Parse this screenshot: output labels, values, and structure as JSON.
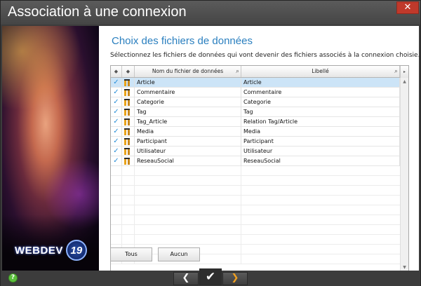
{
  "window": {
    "title": "Association à une connexion",
    "close_glyph": "✕"
  },
  "branding": {
    "logo_text": "WEBDEV",
    "logo_version": "19"
  },
  "content": {
    "heading": "Choix des fichiers de données",
    "instruction": "Sélectionnez les fichiers de données qui vont devenir des fichiers associés à la connexion choisie."
  },
  "table": {
    "columns": {
      "name": "Nom du fichier de données",
      "label": "Libellé"
    },
    "rows": [
      {
        "checked": true,
        "name": "Article",
        "label": "Article",
        "selected": true
      },
      {
        "checked": true,
        "name": "Commentaire",
        "label": "Commentaire",
        "selected": false
      },
      {
        "checked": true,
        "name": "Categorie",
        "label": "Categorie",
        "selected": false
      },
      {
        "checked": true,
        "name": "Tag",
        "label": "Tag",
        "selected": false
      },
      {
        "checked": true,
        "name": "Tag_Article",
        "label": "Relation Tag/Article",
        "selected": false
      },
      {
        "checked": true,
        "name": "Media",
        "label": "Media",
        "selected": false
      },
      {
        "checked": true,
        "name": "Participant",
        "label": "Participant",
        "selected": false
      },
      {
        "checked": true,
        "name": "Utilisateur",
        "label": "Utilisateur",
        "selected": false
      },
      {
        "checked": true,
        "name": "ReseauSocial",
        "label": "ReseauSocial",
        "selected": false
      }
    ],
    "check_glyph": "✓"
  },
  "buttons": {
    "all": "Tous",
    "none": "Aucun"
  },
  "footer": {
    "help": "?",
    "prev": "❮",
    "ok": "✔",
    "next": "❯"
  },
  "icons": {
    "search": "magnifier-icon",
    "check": "check-icon",
    "file": "data-file-icon"
  },
  "colors": {
    "heading": "#2a7fbf",
    "selection": "#cce4f7",
    "check": "#2a8fd8",
    "next_arrow": "#f0a020",
    "help": "#5bbf3c"
  }
}
